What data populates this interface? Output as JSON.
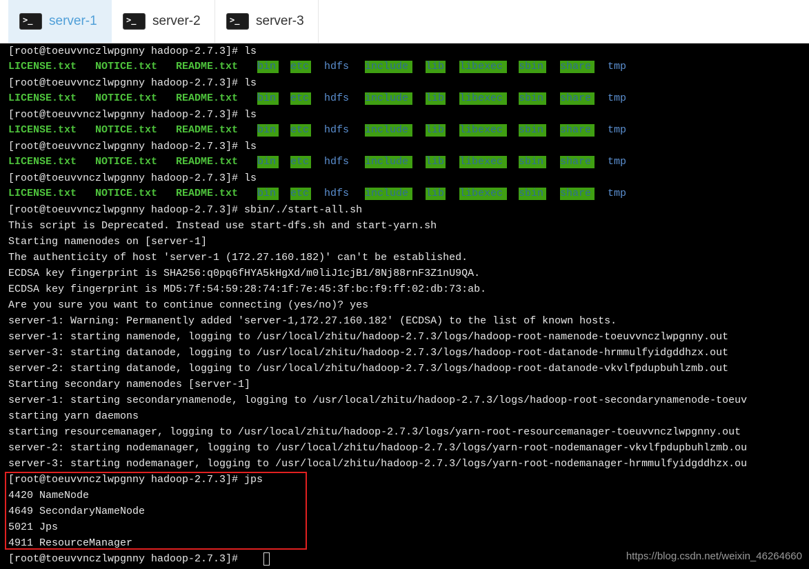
{
  "tabs": [
    {
      "label": "server-1",
      "active": true
    },
    {
      "label": "server-2",
      "active": false
    },
    {
      "label": "server-3",
      "active": false
    }
  ],
  "colors": {
    "ls_file": "#4ec33c",
    "ls_dir": "#5b8fd0",
    "ls_highlight_bg": "#3f9f12",
    "highlight_box": "#e02020",
    "tab_active_text": "#4f9fd8"
  },
  "terminal": {
    "prompt": "[root@toeuvvnczlwpgnny hadoop-2.7.3]# ",
    "ls_command": "ls",
    "ls_items": [
      {
        "text": "LICENSE.txt",
        "kind": "file"
      },
      {
        "text": "NOTICE.txt",
        "kind": "file"
      },
      {
        "text": "README.txt",
        "kind": "file"
      },
      {
        "text": "bin",
        "kind": "hl"
      },
      {
        "text": "etc",
        "kind": "hl"
      },
      {
        "text": "hdfs",
        "kind": "dir"
      },
      {
        "text": "include",
        "kind": "hl"
      },
      {
        "text": "lib",
        "kind": "hl"
      },
      {
        "text": "libexec",
        "kind": "hl"
      },
      {
        "text": "sbin",
        "kind": "hl"
      },
      {
        "text": "share",
        "kind": "hl"
      },
      {
        "text": "tmp",
        "kind": "dir"
      }
    ],
    "ls_repeats": 5,
    "output_lines": [
      "[root@toeuvvnczlwpgnny hadoop-2.7.3]# sbin/./start-all.sh",
      "This script is Deprecated. Instead use start-dfs.sh and start-yarn.sh",
      "Starting namenodes on [server-1]",
      "The authenticity of host 'server-1 (172.27.160.182)' can't be established.",
      "ECDSA key fingerprint is SHA256:q0pq6fHYA5kHgXd/m0liJ1cjB1/8Nj88rnF3Z1nU9QA.",
      "ECDSA key fingerprint is MD5:7f:54:59:28:74:1f:7e:45:3f:bc:f9:ff:02:db:73:ab.",
      "Are you sure you want to continue connecting (yes/no)? yes",
      "server-1: Warning: Permanently added 'server-1,172.27.160.182' (ECDSA) to the list of known hosts.",
      "server-1: starting namenode, logging to /usr/local/zhitu/hadoop-2.7.3/logs/hadoop-root-namenode-toeuvvnczlwpgnny.out",
      "server-3: starting datanode, logging to /usr/local/zhitu/hadoop-2.7.3/logs/hadoop-root-datanode-hrmmulfyidgddhzx.out",
      "server-2: starting datanode, logging to /usr/local/zhitu/hadoop-2.7.3/logs/hadoop-root-datanode-vkvlfpdupbuhlzmb.out",
      "Starting secondary namenodes [server-1]",
      "server-1: starting secondarynamenode, logging to /usr/local/zhitu/hadoop-2.7.3/logs/hadoop-root-secondarynamenode-toeuv",
      "starting yarn daemons",
      "starting resourcemanager, logging to /usr/local/zhitu/hadoop-2.7.3/logs/yarn-root-resourcemanager-toeuvvnczlwpgnny.out",
      "server-2: starting nodemanager, logging to /usr/local/zhitu/hadoop-2.7.3/logs/yarn-root-nodemanager-vkvlfpdupbuhlzmb.ou",
      "server-3: starting nodemanager, logging to /usr/local/zhitu/hadoop-2.7.3/logs/yarn-root-nodemanager-hrmmulfyidgddhzx.ou",
      "[root@toeuvvnczlwpgnny hadoop-2.7.3]# jps",
      "4420 NameNode",
      "4649 SecondaryNameNode",
      "5021 Jps",
      "4911 ResourceManager",
      "[root@toeuvvnczlwpgnny hadoop-2.7.3]# "
    ]
  },
  "watermark": "https://blog.csdn.net/weixin_46264660"
}
